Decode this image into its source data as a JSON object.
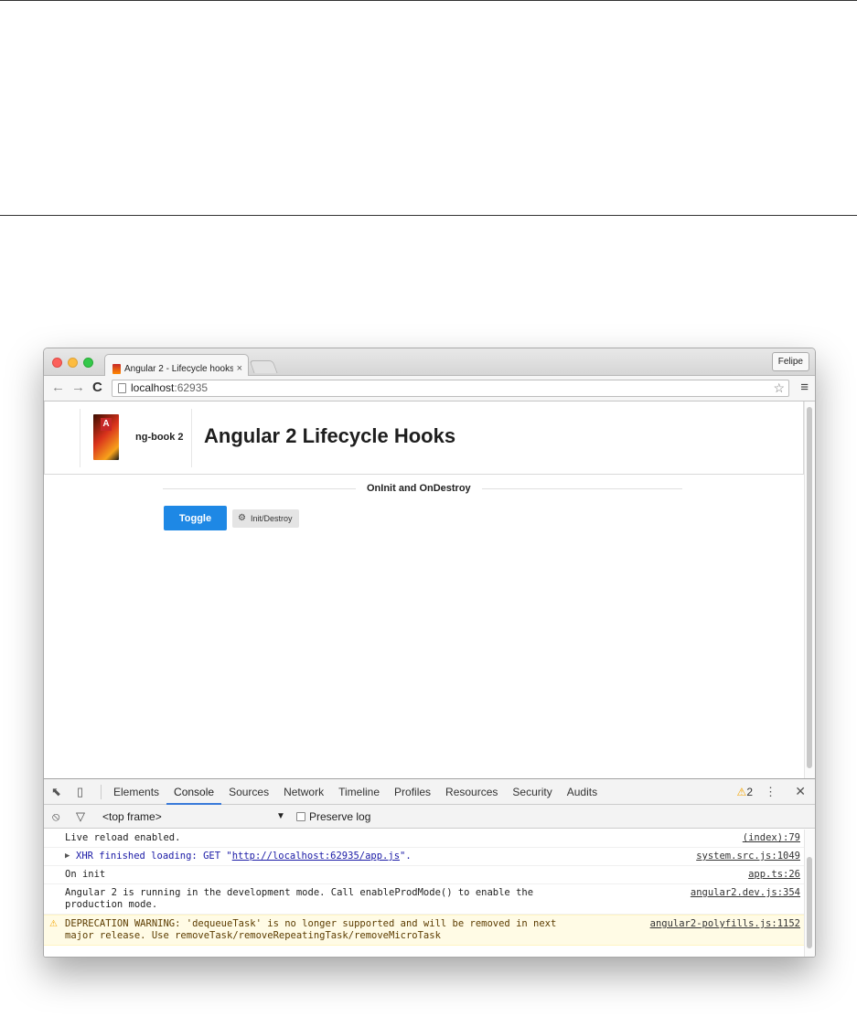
{
  "browser": {
    "tab_title": "Angular 2 - Lifecycle hooks",
    "tab_close": "×",
    "profile_name": "Felipe",
    "url_host": "localhost",
    "url_port": ":62935",
    "icons": {
      "back": "arrow-left",
      "forward": "arrow-right",
      "reload": "reload",
      "star": "star",
      "menu": "hamburger"
    }
  },
  "page": {
    "brand": "ng-book 2",
    "book_letter": "A",
    "title": "Angular 2 Lifecycle Hooks",
    "section_label": "OnInit and OnDestroy",
    "toggle_button": "Toggle",
    "hook_tag": "Init/Destroy",
    "accent_color": "#1e88e5"
  },
  "devtools": {
    "tabs": [
      "Elements",
      "Console",
      "Sources",
      "Network",
      "Timeline",
      "Profiles",
      "Resources",
      "Security",
      "Audits"
    ],
    "active_tab": "Console",
    "warning_count": "2",
    "context": "<top frame>",
    "preserve_log": "Preserve log",
    "logs": [
      {
        "text": "Live reload enabled.",
        "source": "(index):79"
      },
      {
        "prefix": "XHR finished loading: GET \"",
        "link": "http://localhost:62935/app.js",
        "suffix": "\".",
        "source": "system.src.js:1049"
      },
      {
        "text": "On init",
        "source": "app.ts:26"
      },
      {
        "text": "Angular 2 is running in the development mode. Call enableProdMode() to enable the production mode.",
        "source": "angular2.dev.js:354"
      },
      {
        "text": "DEPRECATION WARNING: 'dequeueTask' is no longer supported and will be removed in next major release. Use removeTask/removeRepeatingTask/removeMicroTask",
        "source": "angular2-polyfills.js:1152",
        "level": "warning"
      }
    ]
  }
}
